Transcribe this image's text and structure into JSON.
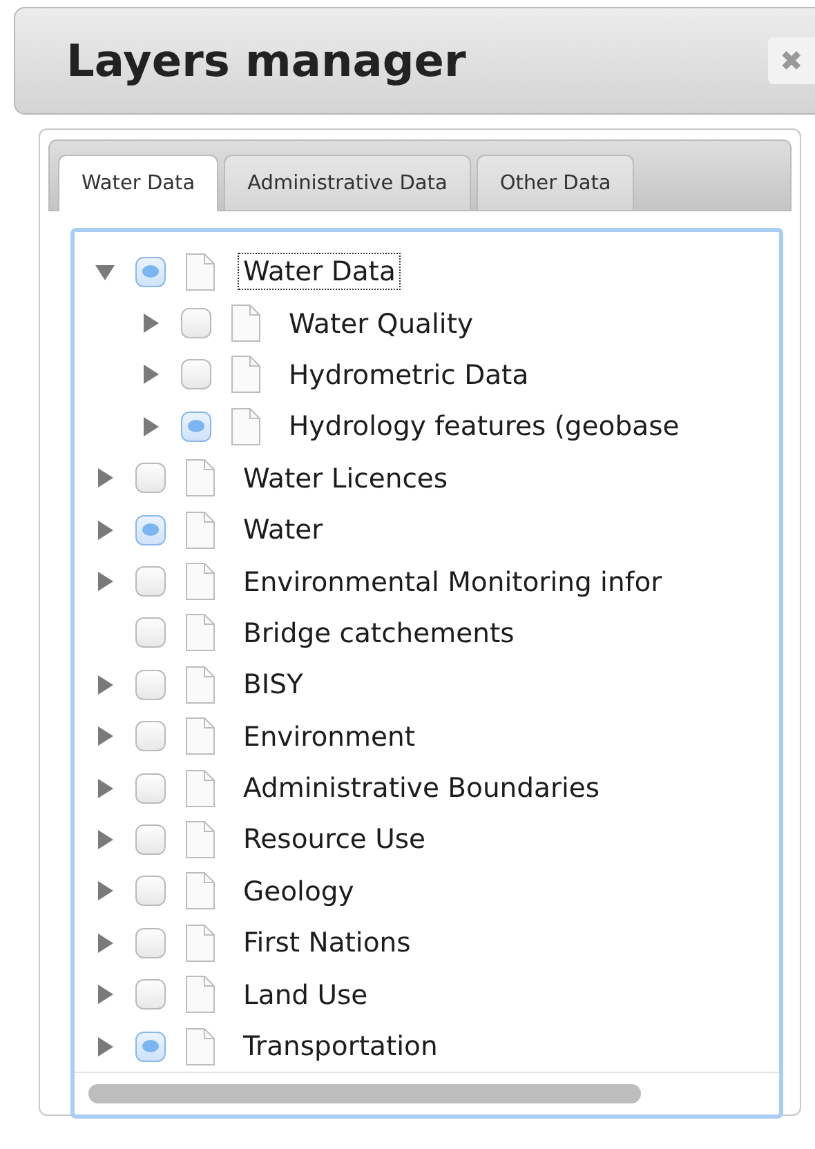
{
  "window": {
    "title": "Layers manager",
    "close": "✖"
  },
  "tabs": [
    {
      "label": "Water Data",
      "selected": true
    },
    {
      "label": "Administrative Data",
      "selected": false
    },
    {
      "label": "Other Data",
      "selected": false
    }
  ],
  "tree": [
    {
      "label": "Water Data",
      "checked": true,
      "expandable": true,
      "expanded": true,
      "focused": true,
      "children": [
        {
          "label": "Water Quality",
          "checked": false,
          "expandable": true,
          "expanded": false,
          "focused": false
        },
        {
          "label": "Hydrometric Data",
          "checked": false,
          "expandable": true,
          "expanded": false,
          "focused": false
        },
        {
          "label": "Hydrology features (geobase",
          "checked": true,
          "expandable": true,
          "expanded": false,
          "focused": false
        }
      ]
    },
    {
      "label": "Water Licences",
      "checked": false,
      "expandable": true,
      "expanded": false,
      "focused": false
    },
    {
      "label": "Water",
      "checked": true,
      "expandable": true,
      "expanded": false,
      "focused": false
    },
    {
      "label": "Environmental Monitoring infor",
      "checked": false,
      "expandable": true,
      "expanded": false,
      "focused": false
    },
    {
      "label": "Bridge catchements",
      "checked": false,
      "expandable": false,
      "focused": false
    },
    {
      "label": "BISY",
      "checked": false,
      "expandable": true,
      "expanded": false,
      "focused": false
    },
    {
      "label": "Environment",
      "checked": false,
      "expandable": true,
      "expanded": false,
      "focused": false
    },
    {
      "label": "Administrative Boundaries",
      "checked": false,
      "expandable": true,
      "expanded": false,
      "focused": false
    },
    {
      "label": "Resource Use",
      "checked": false,
      "expandable": true,
      "expanded": false,
      "focused": false
    },
    {
      "label": "Geology",
      "checked": false,
      "expandable": true,
      "expanded": false,
      "focused": false
    },
    {
      "label": "First Nations",
      "checked": false,
      "expandable": true,
      "expanded": false,
      "focused": false
    },
    {
      "label": "Land Use",
      "checked": false,
      "expandable": true,
      "expanded": false,
      "focused": false
    },
    {
      "label": "Transportation",
      "checked": true,
      "expandable": true,
      "expanded": false,
      "focused": false
    }
  ]
}
